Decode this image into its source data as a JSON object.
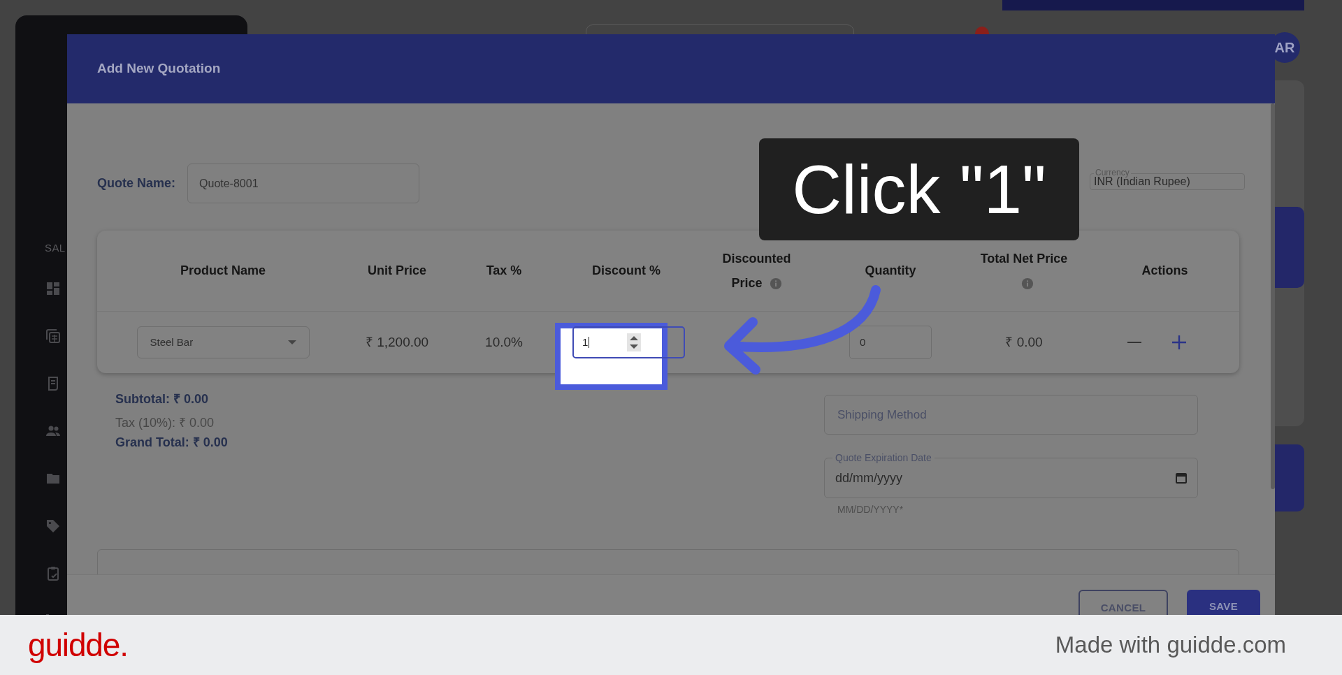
{
  "background": {
    "sidebar_section": "SAL",
    "avatar": "AR"
  },
  "dialog": {
    "title": "Add New Quotation",
    "quote_name": {
      "label": "Quote Name:",
      "value": "Quote-8001"
    },
    "currency": {
      "label": "Currency",
      "value": "INR (Indian Rupee)"
    },
    "table": {
      "columns": [
        {
          "label": "Product Name",
          "info": false
        },
        {
          "label": "Unit Price",
          "info": false
        },
        {
          "label": "Tax %",
          "info": false
        },
        {
          "label": "Discount %",
          "info": false
        },
        {
          "label": "Discounted Price",
          "info": true
        },
        {
          "label": "Quantity",
          "info": false
        },
        {
          "label": "Total Net Price",
          "info": true
        },
        {
          "label": "Actions",
          "info": false
        }
      ],
      "rows": [
        {
          "product": "Steel Bar",
          "unit_price": "₹ 1,200.00",
          "tax": "10.0%",
          "discount": "1",
          "quantity": "0",
          "total": "₹ 0.00"
        }
      ]
    },
    "totals": {
      "subtotal": "Subtotal: ₹ 0.00",
      "tax": "Tax (10%): ₹ 0.00",
      "grand_total": "Grand Total: ₹ 0.00"
    },
    "shipping": {
      "placeholder": "Shipping Method"
    },
    "expiration": {
      "label": "Quote Expiration Date",
      "value": "dd/mm/yyyy",
      "helper": "MM/DD/YYYY*"
    },
    "buttons": [
      "CANCEL",
      "SAVE"
    ]
  },
  "callout": {
    "text": "Click \"1\""
  },
  "footer": {
    "logo": "guidde.",
    "credit": "Made with guidde.com"
  }
}
